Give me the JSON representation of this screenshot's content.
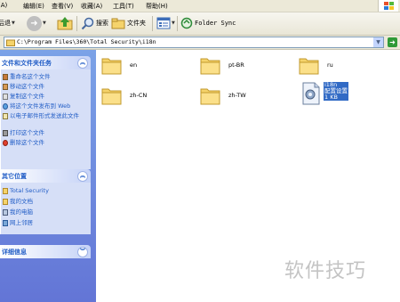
{
  "menubar": {
    "items": [
      "(A)",
      "编辑(E)",
      "查看(V)",
      "收藏(A)",
      "工具(T)",
      "帮助(H)"
    ]
  },
  "toolbar": {
    "back_label": "后退",
    "search_label": "搜索",
    "folders_label": "文件夹",
    "folder_sync_label": "Folder Sync"
  },
  "address": {
    "path": "C:\\Program Files\\360\\Total Security\\i18n"
  },
  "left_pane": {
    "file_tasks": {
      "title": "文件和文件夹任务",
      "items": [
        "重命名这个文件",
        "移动这个文件",
        "复制这个文件",
        "将这个文件发布到 Web",
        "以电子邮件形式发送此文件",
        "打印这个文件",
        "删除这个文件"
      ]
    },
    "other_places": {
      "title": "其它位置",
      "items": [
        "Total Security",
        "我的文档",
        "我的电脑",
        "网上邻居"
      ]
    },
    "details": {
      "title": "详细信息"
    }
  },
  "content": {
    "folders": [
      "en",
      "pt-BR",
      "ru",
      "zh-CN",
      "zh-TW"
    ],
    "file": {
      "name": "i18n",
      "type": "配置设置",
      "size": "1 KB"
    }
  },
  "watermark": "软件技巧",
  "colors": {
    "pane_top": "#7ba2e7",
    "pane_bottom": "#6375d6",
    "task_text": "#215dc6",
    "selection": "#316ac5",
    "folder": "#f5d36b",
    "menubar": "#ece9d8"
  }
}
